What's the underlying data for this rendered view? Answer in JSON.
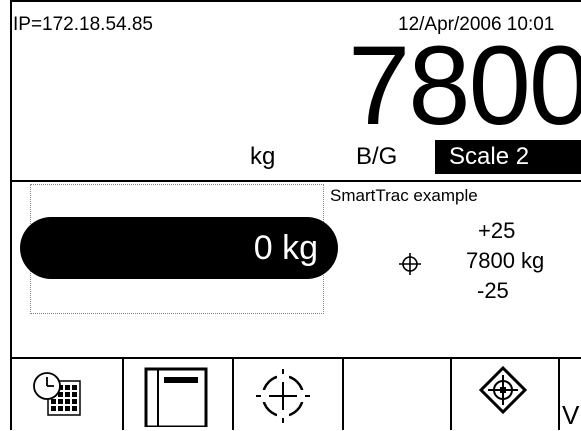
{
  "status_bar": {
    "ip": "IP=172.18.54.85",
    "datetime": "12/Apr/2006 10:01"
  },
  "weight_display": {
    "value": "7800",
    "unit": "kg",
    "mode": "B/G",
    "scale": "Scale 2"
  },
  "smarttrac": {
    "bar_label": "0 kg",
    "title": "SmartTrac example",
    "upper_tolerance": "+25",
    "target": "7800 kg",
    "lower_tolerance": "-25",
    "target_icon": "crosshair-icon"
  },
  "softkeys": [
    {
      "icon": "time-date-calendar-icon"
    },
    {
      "icon": "memory-table-icon"
    },
    {
      "icon": "target-crosshair-icon"
    },
    {
      "icon": "blank"
    },
    {
      "icon": "smarttrac-diamond-icon"
    },
    {
      "icon": "more-arrow-icon",
      "label": "V"
    }
  ]
}
